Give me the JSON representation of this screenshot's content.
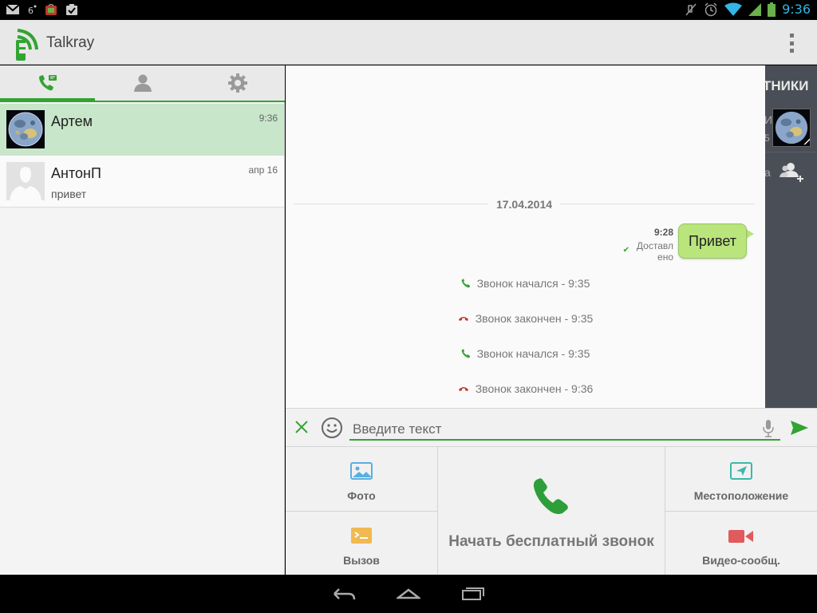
{
  "status_bar": {
    "time": "9:36",
    "left_icons": [
      "gmail-icon",
      "voicemail-icon",
      "shop-icon",
      "task-icon"
    ],
    "right_icons": [
      "mute-icon",
      "alarm-icon",
      "wifi-icon",
      "signal-icon",
      "battery-icon"
    ]
  },
  "app_bar": {
    "title": "Talkray"
  },
  "tabs": [
    {
      "icon": "calls-icon",
      "active": true
    },
    {
      "icon": "contacts-icon",
      "active": false
    },
    {
      "icon": "settings-icon",
      "active": false
    }
  ],
  "chats": [
    {
      "name": "Артем",
      "time": "9:36",
      "preview": "",
      "selected": true,
      "avatar": "moon-avatar"
    },
    {
      "name": "АнтонП",
      "time": "апр 16",
      "preview": "привет",
      "selected": false,
      "avatar": "default-avatar"
    }
  ],
  "conversation": {
    "date": "17.04.2014",
    "message": {
      "text": "Привет",
      "time": "9:28",
      "status_line1": "Доставл",
      "status_line2": "ено"
    },
    "events": [
      {
        "text": "Звонок начался - 9:35",
        "type": "started"
      },
      {
        "text": "Звонок закончен - 9:35",
        "type": "ended"
      },
      {
        "text": "Звонок начался - 9:35",
        "type": "started"
      },
      {
        "text": "Звонок закончен - 9:36",
        "type": "ended"
      }
    ]
  },
  "drawer": {
    "title": "ТНИКИ",
    "snip1": "И",
    "snip2": "5",
    "snip3": "а"
  },
  "compose": {
    "placeholder": "Введите текст",
    "value": ""
  },
  "attachments": {
    "photo": "Фото",
    "call": "Вызов",
    "free_call": "Начать бесплатный звонок",
    "location": "Местоположение",
    "video": "Видео-сообщ."
  },
  "colors": {
    "accent": "#33a333",
    "bubble": "#b9e57c",
    "selected_row": "#c8e6c9",
    "call_end": "#c0392b",
    "status_time": "#33b5e5"
  }
}
